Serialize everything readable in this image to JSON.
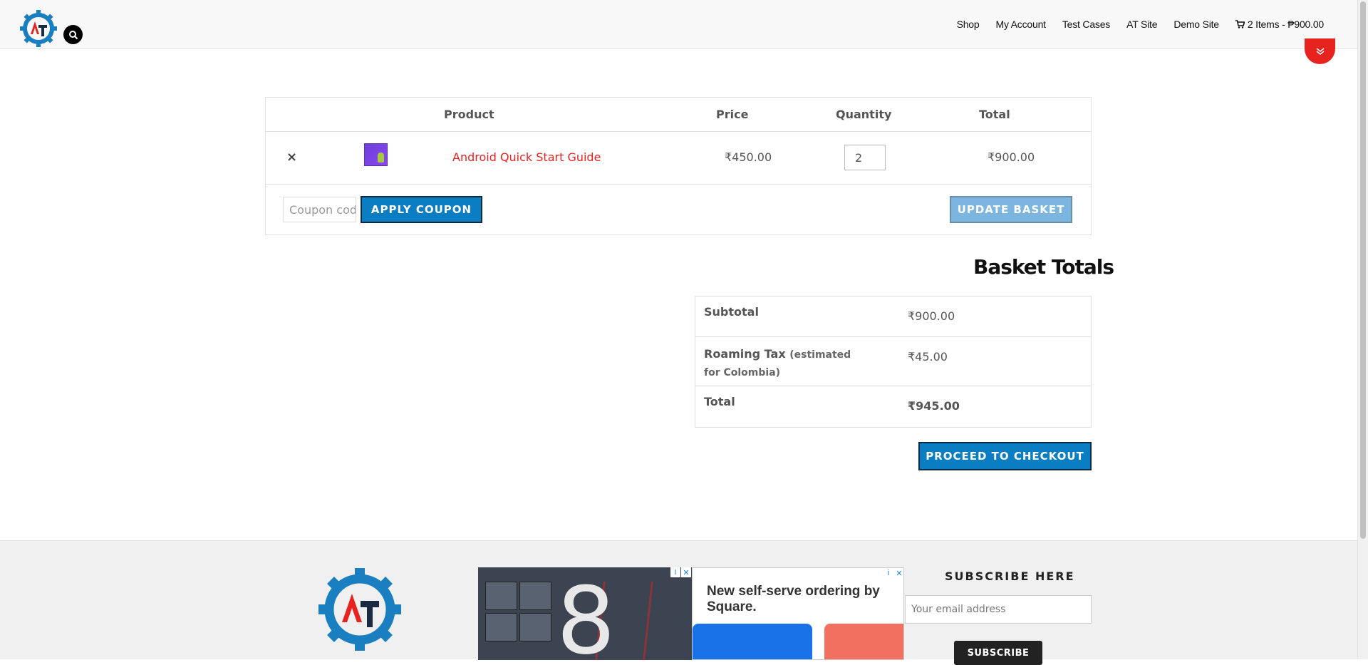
{
  "header": {
    "nav": [
      "Shop",
      "My Account",
      "Test Cases",
      "AT Site",
      "Demo Site"
    ],
    "cart_label": "2 Items - ₱900.00"
  },
  "cart": {
    "columns": [
      "Product",
      "Price",
      "Quantity",
      "Total"
    ],
    "items": [
      {
        "remove": "×",
        "name": "Android Quick Start Guide",
        "price": "₹450.00",
        "quantity": "2",
        "total": "₹900.00"
      }
    ],
    "coupon_placeholder": "Coupon code",
    "apply_coupon": "Apply Coupon",
    "update_basket": "Update Basket"
  },
  "totals": {
    "title": "Basket Totals",
    "subtotal_label": "Subtotal",
    "subtotal_value": "₹900.00",
    "tax_label": "Roaming Tax",
    "tax_note": "(estimated for Colombia)",
    "tax_value": "₹45.00",
    "total_label": "Total",
    "total_value": "₹945.00",
    "checkout": "Proceed to Checkout"
  },
  "footer": {
    "ad1_number": "8",
    "ad2_text": "New self-serve ordering by Square.",
    "subscribe_title": "SUBSCRIBE HERE",
    "email_placeholder": "Your email address",
    "subscribe_button": "Subscribe"
  },
  "colors": {
    "accent_red": "#e6231f",
    "primary_blue": "#0b7dc3",
    "logo_blue": "#1a7fc1"
  }
}
